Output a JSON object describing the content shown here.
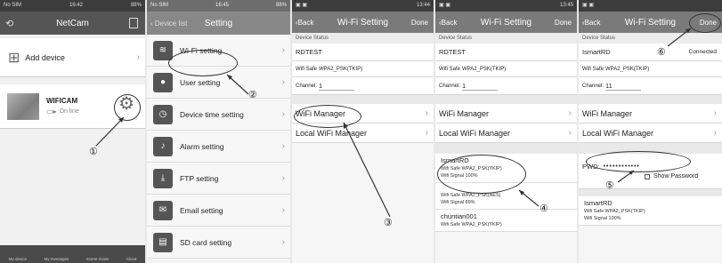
{
  "screens": [
    {
      "status": {
        "carrier": "No SIM",
        "time": "16:42",
        "battery": "88%"
      },
      "title": "NetCam",
      "add_device": "Add device",
      "device": {
        "name": "WIFICAM",
        "status": "On line"
      },
      "marker": "①",
      "tabs": [
        "My device",
        "My messages",
        "Scene mode",
        "About"
      ]
    },
    {
      "status": {
        "carrier": "No SIM",
        "time": "16:45",
        "battery": "88%"
      },
      "back": "Device list",
      "title": "Setting",
      "items": [
        "Wi-Fi setting",
        "User setting",
        "Device time setting",
        "Alarm setting",
        "FTP setting",
        "Email setting",
        "SD card setting"
      ],
      "marker": "②"
    },
    {
      "status": {
        "time": "13:44"
      },
      "back": "Back",
      "title": "Wi-Fi Setting",
      "done": "Done",
      "section": "Device Status",
      "ssid": "RDTEST",
      "wifi_safe_label": "Wifi Safe",
      "wifi_safe": "WPA2_PSK(TKIP)",
      "channel_label": "Channel:",
      "channel": "1",
      "wifi_manager": "WiFi Manager",
      "local_wifi_manager": "Local WiFi Manager",
      "marker": "③"
    },
    {
      "status": {
        "time": "13:45"
      },
      "back": "Back",
      "title": "Wi-Fi Setting",
      "done": "Done",
      "section": "Device Status",
      "ssid": "RDTEST",
      "wifi_safe_label": "Wifi Safe",
      "wifi_safe": "WPA2_PSK(TKIP)",
      "channel_label": "Channel:",
      "channel": "1",
      "wifi_manager": "WiFi Manager",
      "local_wifi_manager": "Local WiFi Manager",
      "networks": [
        {
          "name": "IsmartRD",
          "safe": "Wifi Safe  WPA2_PSK(TKIP)",
          "signal": "Wifi Signal  100%"
        },
        {
          "name": "",
          "safe": "Wifi Safe  WPA2_PSK(AES)",
          "signal": "Wifi Signal  89%"
        },
        {
          "name": "chuntian001",
          "safe": "Wifi Safe  WPA2_PSK(TKIP)",
          "signal": ""
        }
      ],
      "marker": "④"
    },
    {
      "status": {
        "time": ""
      },
      "back": "Back",
      "title": "Wi-Fi Setting",
      "done": "Done",
      "section": "Device Status",
      "ssid": "IsmartRD",
      "connected": "Connected",
      "wifi_safe_label": "Wifi Safe",
      "wifi_safe": "WPA2_PSK(TKIP)",
      "channel_label": "Channel:",
      "channel": "11",
      "wifi_manager": "WiFi Manager",
      "local_wifi_manager": "Local WiFi Manager",
      "pwd_label": "PWD:",
      "pwd_mask": "••••••••••••",
      "show_password": "Show Password",
      "network": {
        "name": "IsmartRD",
        "safe": "Wifi Safe  WPA2_PSK(TKIP)",
        "signal": "Wifi Signal  100%"
      },
      "marker_done": "⑥",
      "marker_pwd": "⑤"
    }
  ]
}
